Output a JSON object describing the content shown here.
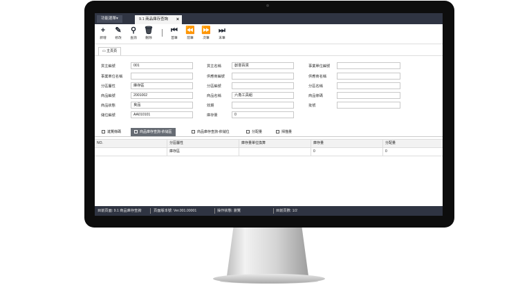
{
  "tabbar": {
    "menu_label": "功能選單▾",
    "active_tab": "9.1 商品庫存查詢",
    "close_glyph": "×"
  },
  "toolbar": [
    {
      "icon": "plus-icon",
      "glyph": "+",
      "label": "新增"
    },
    {
      "icon": "edit-icon",
      "glyph": "✎",
      "label": "修改"
    },
    {
      "icon": "search-icon",
      "glyph": "⚲",
      "label": "查詢"
    },
    {
      "icon": "trash-icon",
      "glyph": "🗑",
      "label": "刪除"
    },
    {
      "icon": "first-icon",
      "glyph": "⏮",
      "label": "首筆"
    },
    {
      "icon": "prev-icon",
      "glyph": "⏪",
      "label": "前筆"
    },
    {
      "icon": "next-icon",
      "glyph": "⏩",
      "label": "次筆"
    },
    {
      "icon": "last-icon",
      "glyph": "⏭",
      "label": "末筆"
    }
  ],
  "main_tab": "主頁頁",
  "form": {
    "row1": {
      "l1": "貨主編號",
      "v1": "001",
      "l2": "貨主名稱",
      "v2": "創意百貨",
      "l3": "事業單位編號",
      "v3": ""
    },
    "row2": {
      "l1": "事業單位名稱",
      "v1": "",
      "l2": "供應商編號",
      "v2": "",
      "l3": "供應商名稱",
      "v3": ""
    },
    "row3": {
      "l1": "分區屬性",
      "v1": "庫存區",
      "l2": "分區編號",
      "v2": "",
      "l3": "分區名稱",
      "v3": ""
    },
    "row4": {
      "l1": "商品編號",
      "v1": "2001002",
      "l2": "商品名稱",
      "v2": "六角工具組",
      "l3": "商品條碼",
      "v3": ""
    },
    "row5": {
      "l1": "商品狀態",
      "v1": "良品",
      "l2": "效期",
      "v2": "",
      "l3": "批號",
      "v3": ""
    },
    "row6": {
      "l1": "儲位編號",
      "v1": "AA010101",
      "l2": "庫存量",
      "v2": "0"
    }
  },
  "subtabs": [
    "進覽條碼",
    "商品庫存查詢-依儲區",
    "商品庫存查詢-依儲位",
    "分配量",
    "掃描量"
  ],
  "grid": {
    "headers": [
      "NO.",
      "分區屬性",
      "庫存量單位換算",
      "庫存量",
      "分配量"
    ],
    "rows": [
      [
        "",
        "庫存區",
        "",
        "0",
        "0"
      ]
    ]
  },
  "status": {
    "page_label": "目前頁面: 9.1 商品庫存查詢",
    "version": "頁面版本號: Ver.001.00001",
    "state": "操作狀態: 瀏覽",
    "page_count": "目前頁數: 1/2"
  }
}
